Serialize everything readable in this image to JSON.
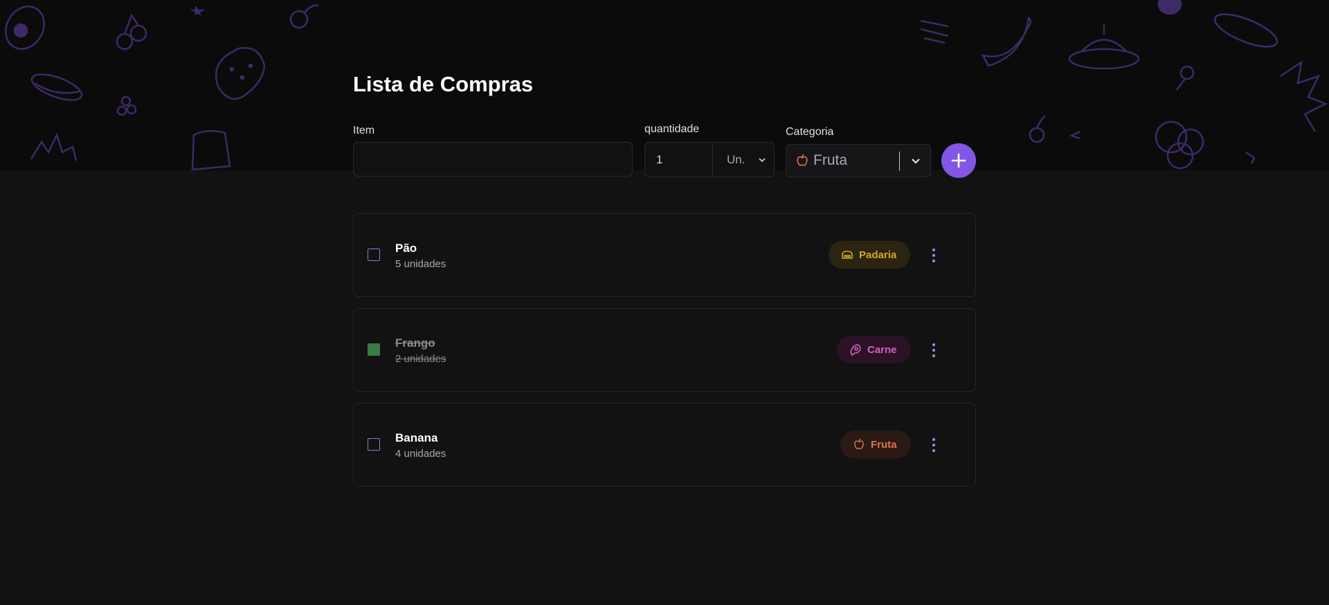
{
  "page": {
    "title": "Lista de Compras"
  },
  "form": {
    "item_label": "Item",
    "item_value": "",
    "quantity_label": "quantidade",
    "quantity_value": "1",
    "unit_value": "Un.",
    "category_label": "Categoria",
    "category_value": "Fruta",
    "add_icon": "plus-icon"
  },
  "items": [
    {
      "name": "Pão",
      "qty": "5 unidades",
      "checked": false,
      "category": "Padaria",
      "icon": "bread-icon",
      "color": "#d6a72f",
      "bg": "#2a2410"
    },
    {
      "name": "Frango",
      "qty": "2 unidades",
      "checked": true,
      "category": "Carne",
      "icon": "meat-icon",
      "color": "#d85fc4",
      "bg": "#2b1226"
    },
    {
      "name": "Banana",
      "qty": "4 unidades",
      "checked": false,
      "category": "Fruta",
      "icon": "apple-icon",
      "color": "#e0714f",
      "bg": "#2b1a14"
    }
  ],
  "colors": {
    "accent": "#8257e5",
    "checked": "#3a7d44",
    "background": "#121212"
  }
}
